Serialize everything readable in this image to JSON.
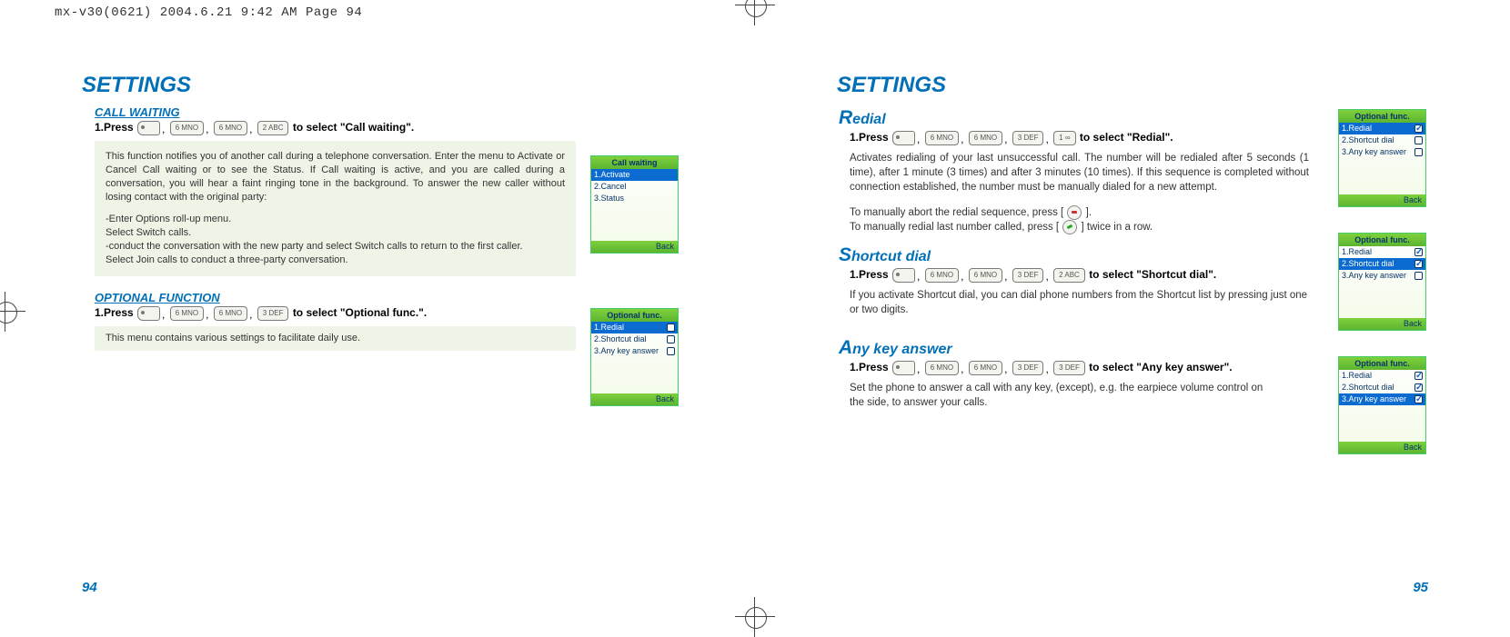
{
  "header": "mx-v30(0621)  2004.6.21  9:42 AM  Page 94",
  "left": {
    "section": "SETTINGS",
    "callWaiting": {
      "heading": "CALL WAITING",
      "pressPrefix": "1.Press",
      "keys": [
        "soft",
        "6 MNO",
        "6 MNO",
        "2 ABC"
      ],
      "pressSuffix": " to select \"Call waiting\".",
      "desc1": "This function notifies you of another call during a telephone conversation. Enter the menu to Activate or Cancel Call waiting or to see the Status. If Call waiting is active, and you are called during a conversation, you will hear a faint ringing tone in the background. To answer the new caller without losing contact with the original party:",
      "desc2": "-Enter Options roll-up menu.\nSelect Switch calls.\n -conduct the conversation with the new party and select Switch calls to return to the first caller.\nSelect Join calls to conduct a three-party conversation."
    },
    "optional": {
      "heading": "OPTIONAL FUNCTION",
      "pressPrefix": "1.Press",
      "keys": [
        "soft",
        "6 MNO",
        "6 MNO",
        "3 DEF"
      ],
      "pressSuffix": " to select \"Optional func.\".",
      "desc": "This menu contains various settings to facilitate daily use."
    },
    "pageNum": "94",
    "mockCallWaiting": {
      "title": "Call waiting",
      "items": [
        "1.Activate",
        "2.Cancel",
        "3.Status"
      ],
      "selected": 0,
      "back": "Back"
    },
    "mockOptional": {
      "title": "Optional func.",
      "items": [
        "1.Redial",
        "2.Shortcut dial",
        "3.Any key answer"
      ],
      "selected": 0,
      "checks": [
        false,
        false,
        false
      ],
      "back": "Back"
    }
  },
  "right": {
    "section": "SETTINGS",
    "redial": {
      "heading": "Redial",
      "pressPrefix": "1.Press",
      "keys": [
        "soft",
        "6 MNO",
        "6 MNO",
        "3 DEF",
        "1 ∞"
      ],
      "pressSuffix": " to select \"Redial\".",
      "desc": "Activates redialing of your last unsuccessful call. The number will be redialed after 5 seconds (1 time), after 1 minute (3 times) and after 3 minutes (10 times). If this sequence is completed without connection established, the number must be manually dialed for a new attempt.",
      "abortLine": "To manually abort the redial sequence, press [      ].",
      "manualLine": "To manually redial last number called, press [      ] twice in a row."
    },
    "shortcut": {
      "heading": "Shortcut dial",
      "pressPrefix": "1.Press",
      "keys": [
        "soft",
        "6 MNO",
        "6 MNO",
        "3 DEF",
        "2 ABC"
      ],
      "pressSuffix": " to select \"Shortcut dial\".",
      "desc": "If you activate Shortcut dial, you can dial phone numbers from the Shortcut list by pressing just one or two digits."
    },
    "anykey": {
      "heading": "Any key answer",
      "pressPrefix": "1.Press",
      "keys": [
        "soft",
        "6 MNO",
        "6 MNO",
        "3 DEF",
        "3 DEF"
      ],
      "pressSuffix": " to select \"Any key answer\".",
      "desc": "Set the phone to answer a call with any key, (except), e.g. the earpiece volume control on the side, to answer your calls."
    },
    "pageNum": "95",
    "mockRedial": {
      "title": "Optional func.",
      "items": [
        "1.Redial",
        "2.Shortcut dial",
        "3.Any key answer"
      ],
      "selected": 0,
      "checks": [
        true,
        false,
        false
      ],
      "back": "Back"
    },
    "mockShortcut": {
      "title": "Optional func.",
      "items": [
        "1.Redial",
        "2.Shortcut dial",
        "3.Any key answer"
      ],
      "selected": 1,
      "checks": [
        true,
        true,
        false
      ],
      "back": "Back"
    },
    "mockAnykey": {
      "title": "Optional func.",
      "items": [
        "1.Redial",
        "2.Shortcut dial",
        "3.Any key answer"
      ],
      "selected": 2,
      "checks": [
        true,
        true,
        true
      ],
      "back": "Back"
    }
  }
}
